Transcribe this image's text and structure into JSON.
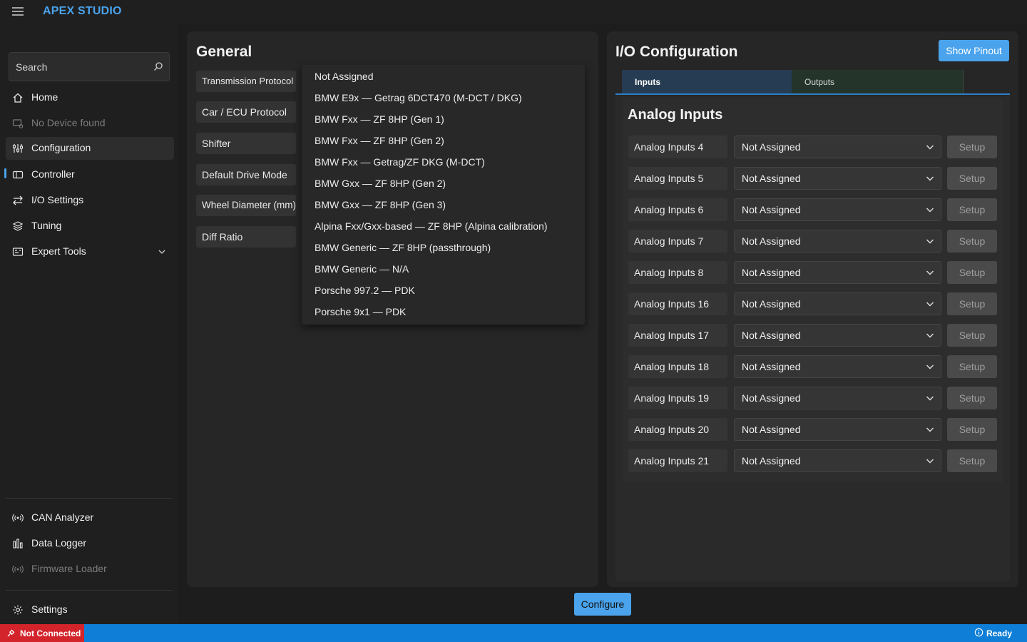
{
  "app": {
    "title": "APEX STUDIO"
  },
  "sidebar": {
    "search_placeholder": "Search",
    "items": [
      {
        "label": "Home",
        "icon": "home-icon"
      },
      {
        "label": "No Device found",
        "icon": "device-icon",
        "disabled": true
      },
      {
        "label": "Configuration",
        "icon": "sliders-icon",
        "active": true
      },
      {
        "label": "Controller",
        "icon": "controller-icon"
      },
      {
        "label": "I/O Settings",
        "icon": "arrows-swap-icon"
      },
      {
        "label": "Tuning",
        "icon": "layers-icon"
      },
      {
        "label": "Expert Tools",
        "icon": "tools-icon"
      }
    ],
    "bottom_items": [
      {
        "label": "CAN Analyzer",
        "icon": "broadcast-icon"
      },
      {
        "label": "Data Logger",
        "icon": "bar-chart-icon"
      },
      {
        "label": "Firmware Loader",
        "icon": "broadcast-icon",
        "disabled": true
      }
    ],
    "settings_label": "Settings"
  },
  "general": {
    "title": "General",
    "params": [
      "Transmission Protocol",
      "Car / ECU Protocol",
      "Shifter",
      "Default Drive Mode",
      "Wheel Diameter (mm)",
      "Diff Ratio"
    ],
    "dropdown_options": [
      "Not Assigned",
      "BMW E9x — Getrag 6DCT470 (M-DCT / DKG)",
      "BMW Fxx — ZF 8HP (Gen 1)",
      "BMW Fxx — ZF 8HP (Gen 2)",
      "BMW Fxx — Getrag/ZF DKG (M-DCT)",
      "BMW Gxx — ZF 8HP (Gen 2)",
      "BMW Gxx — ZF 8HP (Gen 3)",
      "Alpina Fxx/Gxx-based — ZF 8HP (Alpina calibration)",
      "BMW Generic — ZF 8HP (passthrough)",
      "BMW Generic — N/A",
      "Porsche 997.2 — PDK",
      "Porsche 9x1 — PDK"
    ]
  },
  "io": {
    "title": "I/O Configuration",
    "show_pinout": "Show Pinout",
    "tabs": [
      "Inputs",
      "Outputs"
    ],
    "section_title": "Analog Inputs",
    "setup_label": "Setup",
    "rows": [
      {
        "label": "Analog Inputs 4",
        "value": "Not Assigned"
      },
      {
        "label": "Analog Inputs 5",
        "value": "Not Assigned"
      },
      {
        "label": "Analog Inputs 6",
        "value": "Not Assigned"
      },
      {
        "label": "Analog Inputs 7",
        "value": "Not Assigned"
      },
      {
        "label": "Analog Inputs 8",
        "value": "Not Assigned"
      },
      {
        "label": "Analog Inputs 16",
        "value": "Not Assigned"
      },
      {
        "label": "Analog Inputs 17",
        "value": "Not Assigned"
      },
      {
        "label": "Analog Inputs 18",
        "value": "Not Assigned"
      },
      {
        "label": "Analog Inputs 19",
        "value": "Not Assigned"
      },
      {
        "label": "Analog Inputs 20",
        "value": "Not Assigned"
      },
      {
        "label": "Analog Inputs 21",
        "value": "Not Assigned"
      }
    ]
  },
  "configure_label": "Configure",
  "status": {
    "connection": "Not Connected",
    "state": "Ready"
  },
  "colors": {
    "accent": "#4aa3ec",
    "statusbar": "#0e7ed6",
    "error": "#d3242c"
  }
}
